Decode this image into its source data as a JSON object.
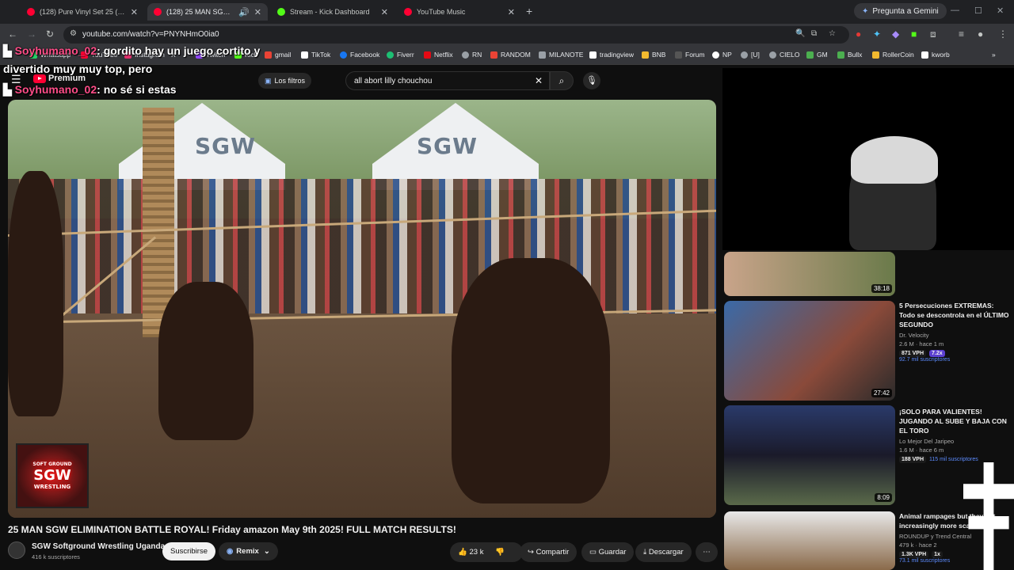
{
  "browser": {
    "tabs": [
      {
        "title": "(128) Pure Vinyl Set 25 (Classic",
        "color": "#ff0033"
      },
      {
        "title": "(128) 25 MAN SGW ELIMIN",
        "color": "#ff0033"
      },
      {
        "title": "Stream - Kick Dashboard",
        "color": "#53fc18"
      },
      {
        "title": "YouTube Music",
        "color": "#ff0033"
      }
    ],
    "gemini_label": "Pregunta a Gemini",
    "url": "youtube.com/watch?v=PNYNHmO0ia0",
    "bookmarks": [
      {
        "label": "Whatsapp",
        "color": "#25d366"
      },
      {
        "label": "YouTube",
        "color": "#ff0033"
      },
      {
        "label": "Instagram",
        "color": "#e1306c"
      },
      {
        "label": "X",
        "color": "#ffffff"
      },
      {
        "label": "Twitch",
        "color": "#9146ff"
      },
      {
        "label": "Kick",
        "color": "#53fc18"
      },
      {
        "label": "gmail",
        "color": "#ea4335"
      },
      {
        "label": "TikTok",
        "color": "#ffffff"
      },
      {
        "label": "Facebook",
        "color": "#1877f2"
      },
      {
        "label": "Fiverr",
        "color": "#1dbf73"
      },
      {
        "label": "Netflix",
        "color": "#e50914"
      },
      {
        "label": "RN",
        "color": "#9aa0a6"
      },
      {
        "label": "RANDOM",
        "color": "#ea4335"
      },
      {
        "label": "MILANOTE",
        "color": "#9aa0a6"
      },
      {
        "label": "tradingview",
        "color": "#ffffff"
      },
      {
        "label": "BNB",
        "color": "#f3ba2f"
      },
      {
        "label": "Forum",
        "color": "#555555"
      },
      {
        "label": "NP",
        "color": "#ffffff"
      },
      {
        "label": "[U]",
        "color": "#9aa0a6"
      },
      {
        "label": "CIELO",
        "color": "#9aa0a6"
      },
      {
        "label": "GM",
        "color": "#4caf50"
      },
      {
        "label": "Bullx",
        "color": "#4caf50"
      },
      {
        "label": "RollerCoin",
        "color": "#f3ba2f"
      },
      {
        "label": "kworb",
        "color": "#ffffff"
      }
    ]
  },
  "youtube": {
    "premium_label": "Premium",
    "filters_label": "Los filtros",
    "search_value": "all abort lilly chouchou"
  },
  "chat": [
    {
      "user": "Soyhumano_02",
      "text": ": gordito hay un juego cortito y"
    },
    {
      "user": "",
      "text": "divertido muy muy top, pero"
    },
    {
      "user": "Soyhumano_02",
      "text": ": no sé si estas"
    }
  ],
  "player": {
    "tent_text": "SGW",
    "badge_text": "SGW",
    "badge_sub": "SOFT GROUND",
    "badge_sub2": "WRESTLING"
  },
  "video": {
    "title": "25 MAN SGW ELIMINATION BATTLE ROYAL! Friday amazon May 9th 2025! FULL MATCH RESULTS!",
    "channel": "SGW Softground Wrestling Uganda",
    "subs": "416 k suscriptores",
    "subscribe_label": "Suscribirse",
    "remix_label": "Remix",
    "likes": "23 k",
    "share_label": "Compartir",
    "save_label": "Guardar",
    "download_label": "Descargar"
  },
  "sidebar": [
    {
      "duration": "38:18",
      "title": "",
      "channel": "",
      "stats": "",
      "vph": "",
      "mult": "",
      "subs": ""
    },
    {
      "duration": "27:42",
      "title": "5 Persecuciones EXTREMAS: Todo se descontrola en el ÚLTIMO SEGUNDO",
      "channel": "Dr. Velocity",
      "stats": "2.6 M · hace 1 m",
      "vph": "871 VPH",
      "mult": "7.2x",
      "subs": "92.7 mil suscriptores"
    },
    {
      "duration": "8:09",
      "title": "¡SOLO PARA VALIENTES! JUGANDO AL SUBE Y BAJA CON EL TORO",
      "channel": "Lo Mejor Del Jaripeo",
      "stats": "1.6 M · hace 6 m",
      "vph": "188 VPH",
      "mult": "",
      "subs": "115 mil suscriptores"
    },
    {
      "duration": "",
      "title": "Animal rampages but they get increasingly more sca",
      "channel": "ROUNDUP y Trend Central",
      "stats": "479 k · hace 2",
      "vph": "1.3K VPH",
      "mult": "1x",
      "subs": "73.1 mil suscriptores"
    }
  ]
}
